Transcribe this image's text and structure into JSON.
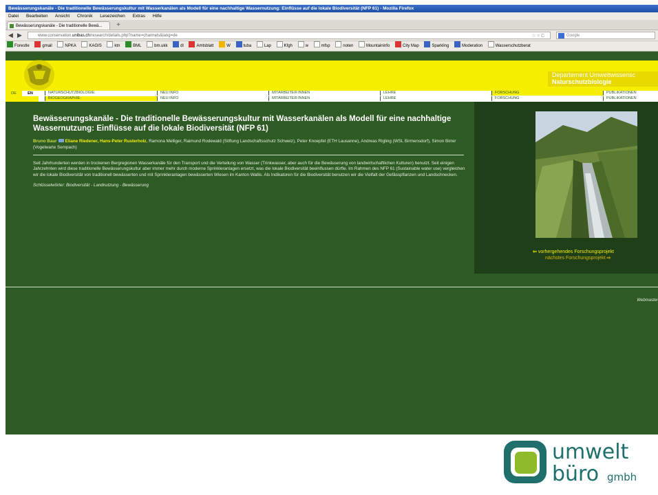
{
  "browser": {
    "window_title": "Bewässerungskanäle - Die traditionelle Bewässerungskultur mit Wasserkanälen als Modell für eine nachhaltige Wassernutzung: Einflüsse auf die lokale Biodiversität (NFP 61) - Mozilla Firefox",
    "menu": [
      "Datei",
      "Bearbeiten",
      "Ansicht",
      "Chronik",
      "Lesezeichen",
      "Extras",
      "Hilfe"
    ],
    "tab_label": "Bewässerungskanäle - Die traditionelle Bewä...",
    "new_tab": "+",
    "url_prefix": "www.conservation.",
    "url_domain": "unibas.ch",
    "url_suffix": "/research/details.php?name=channels&lang=de",
    "search_placeholder": "Google",
    "bookmarks": [
      "Forestle",
      "gmail",
      "NPKA",
      "KAGIS",
      "ktn",
      "BML",
      "bm.ukk",
      "dl",
      "Amtsblatt",
      "W",
      "tuba",
      "Lap",
      "Kfgh",
      "w",
      "mfsp",
      "noten",
      "Mountaininfo",
      "City Map",
      "Sparkling",
      "Moderation",
      "Wasserschutzberat"
    ]
  },
  "site": {
    "dept_line1": "Departement Umweltwissensc",
    "dept_line2": "Naturschutzbiologie",
    "lang": [
      "DE",
      "EN"
    ],
    "nav_row1": [
      "NATURSCHUTZBIOLOGIE:",
      "NEU:INFO",
      "MITARBEITER:INNEN",
      "LEHRE",
      "FORSCHUNG",
      "PUBLIKATIONEN"
    ],
    "nav_row2": [
      "BIOGEOGRAPHIE:",
      "NEU:INFO",
      "MITARBEITER:INNEN",
      "LEHRE",
      "FORSCHUNG",
      "PUBLIKATIONEN"
    ]
  },
  "article": {
    "title": "Bewässerungskanäle - Die traditionelle Bewässerungskultur mit Wasserkanälen als Modell für eine nachhaltige Wassernutzung: Einflüsse auf die lokale Biodiversität (NFP 61)",
    "author1": "Bruno Baur",
    "author2": "Eliane Riedener, Hans-Peter Rusterholz",
    "authors_rest": ", Ramona Melliger, Raimund Rodewald (Stiftung Landschaftsschutz Schweiz), Peter Knoepfel (ETH Lausanne), Andreas Rigling (WSL Birmensdorf), Simon Birrer (Vogelwarte Sempach)",
    "abstract": "Seit Jahrhunderten werden in trockenen Bergregionen Wasserkanäle für den Transport und die Verteilung von Wasser (Trinkwasser, aber auch für die Bewässerung von landwirtschaftlichen Kulturen) benutzt. Seit einigen Jahrzehnten wird diese traditionelle Bewässerungskultur aber immer mehr durch moderne Sprinkleranlagen ersetzt, was die lokale Biodiversität beeinflussen dürfte. Im Rahmen des NFP 61 (Sustainable water use) vergleichen wir die lokale Biodiversität von traditionell bewässerten und mit Sprinkleranlagen bewässerten Wiesen im Kanton Wallis. Als Indikatoren für die Biodiversität benutzen wir die Vielfalt der Gefässpflanzen und Landschnecken.",
    "keywords": "Schlüsselwörter: Biodiversität - Landnutzung - Bewässerung",
    "prev_link": "vorhergehendes Forschungsprojekt",
    "next_link": "nächstes Forschungsprojekt",
    "webmaster": "Webmaster"
  },
  "branding": {
    "word1": "umwelt",
    "word2": "büro",
    "word3": "gmbh"
  }
}
